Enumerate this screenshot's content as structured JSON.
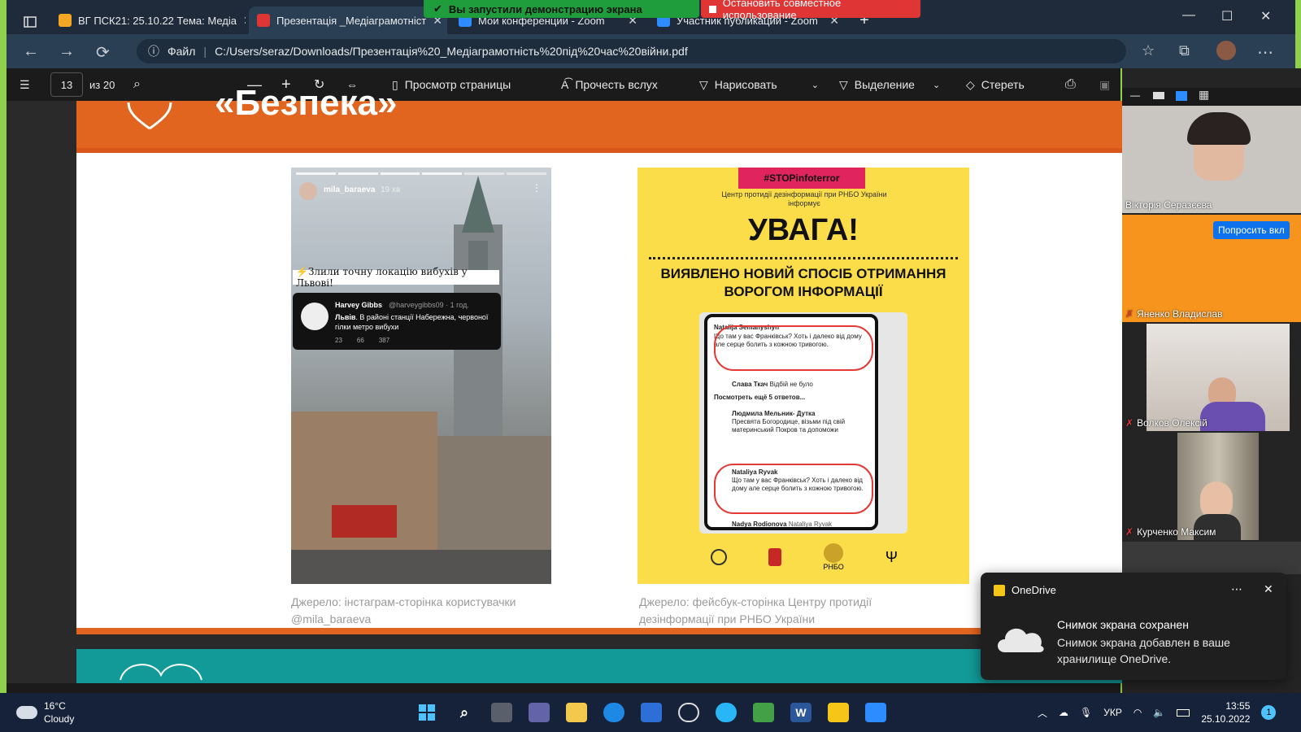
{
  "browser": {
    "tabs": [
      {
        "label": "ВГ ПСК21: 25.10.22 Тема: Медіа",
        "favicon_color": "#f5a623"
      },
      {
        "label": "Презентація _Медіаграмотніст",
        "favicon_color": "#e03535"
      },
      {
        "label": "Мои конференции - Zoom",
        "favicon_color": "#2d8cff"
      },
      {
        "label": "Участник публикации - Zoom",
        "favicon_color": "#2d8cff"
      }
    ],
    "share_banner": "Вы запустили демонстрацию экрана",
    "stop_share": "Остановить совместное использование",
    "address": {
      "scheme_label": "Файл",
      "url": "C:/Users/seraz/Downloads/Презентація%20_Медіаграмотність%20під%20час%20війни.pdf"
    }
  },
  "pdf_toolbar": {
    "page_current": "13",
    "page_total": "из 20",
    "page_view": "Просмотр страницы",
    "read_aloud": "Прочесть вслух",
    "draw": "Нарисовать",
    "highlight": "Выделение",
    "erase": "Стереть"
  },
  "slide": {
    "header_fragment": "«Безпека»",
    "left_post": {
      "username": "mila_baraeva",
      "time": "19 хв",
      "headline": "⚡Злили точну локацію вибухів у Львові!",
      "tweet_author": "Harvey Gibbs",
      "tweet_handle": "@harveygibbs09 · 1 год.",
      "tweet_text_bold": "Львів",
      "tweet_text": ". В районі станції Набережна, червоної гілки метро вибухи",
      "tweet_stats": [
        "23",
        "66",
        "387"
      ]
    },
    "right_post": {
      "tag": "#STOPinfoterror",
      "org": "Центр протидії дезінформації при РНБО України інформує",
      "title": "УВАГА!",
      "subtitle": "ВИЯВЛЕНО НОВИЙ СПОСІБ ОТРИМАННЯ ВОРОГОМ ІНФОРМАЦІЇ",
      "comments": [
        {
          "name": "Natalija Semanyshyn",
          "text": "Що там у вас Франківськ? Хоть і далеко від дому але серце болить з кожною тривогою."
        },
        {
          "name": "Слава Ткач",
          "text": "Відбій не було"
        },
        {
          "name": "",
          "text": "Посмотреть ещё 5 ответов..."
        },
        {
          "name": "Людмила Мельник- Дутка",
          "text": "Пресвята Богородице, візьми під свій материнський Покров та допоможи"
        },
        {
          "name": "Nataliya Ryvak",
          "text": "Що там у вас Франківськ? Хоть і далеко від дому але серце болить з кожною тривогою."
        },
        {
          "name": "Nadya Rodionova",
          "text": "Nataliya Ryvak"
        }
      ],
      "logo_label": "РНБО"
    },
    "caption_left": "Джерело: інстаграм-сторінка користувачки @mila_baraeva",
    "caption_right": "Джерело: фейсбук-сторінка Центру протидії дезінформації при РНБО України"
  },
  "zoom": {
    "participants": [
      {
        "name": "Вікторія Серазєєва",
        "muted": false
      },
      {
        "name": "Яненко Владислав",
        "muted": true
      },
      {
        "name": "Волков Олексій",
        "muted": true
      },
      {
        "name": "Курченко Максим",
        "muted": true
      }
    ],
    "request_button": "Попросить вкл"
  },
  "toast": {
    "app": "OneDrive",
    "title": "Снимок экрана сохранен",
    "body": "Снимок экрана добавлен в ваше хранилище OneDrive."
  },
  "taskbar": {
    "weather_temp": "16°C",
    "weather_desc": "Cloudy",
    "language": "УКР",
    "time": "13:55",
    "date": "25.10.2022",
    "notifications": "1"
  }
}
